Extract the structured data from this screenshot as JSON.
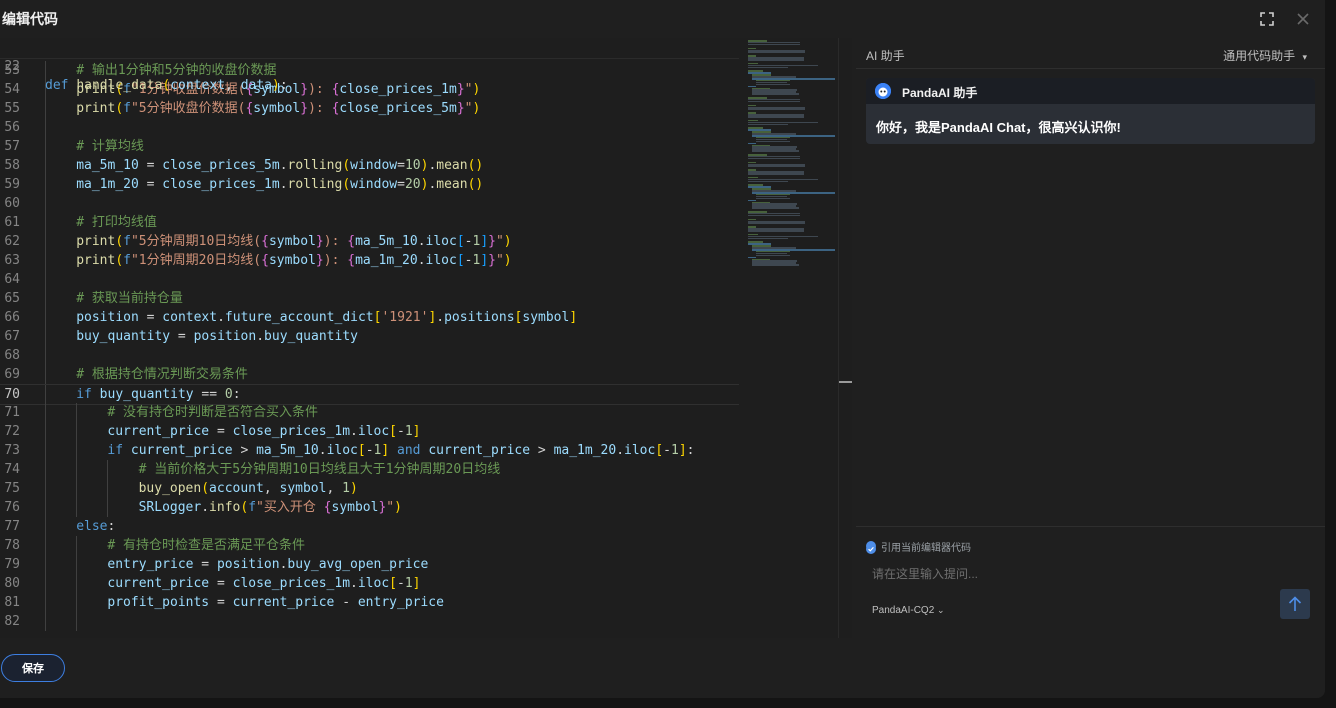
{
  "dialog": {
    "title": "编辑代码",
    "save_label": "保存"
  },
  "editor": {
    "sticky": {
      "ln": "22",
      "html": "<span class=\"tok-kw\">def</span> <span class=\"tok-fn\">handle_data</span><span class=\"tok-p1\">(</span><span class=\"tok-var\">context</span>, <span class=\"tok-var\">data</span><span class=\"tok-p1\">)</span>:"
    },
    "current_line": "70",
    "lines": [
      {
        "ln": "53",
        "indent": 1,
        "html": "<span class=\"tok-cm\"># 输出1分钟和5分钟的收盘价数据</span>"
      },
      {
        "ln": "54",
        "indent": 1,
        "html": "<span class=\"tok-fn\">print</span><span class=\"tok-p1\">(</span><span class=\"tok-kw\">f</span><span class=\"tok-str\">\"1分钟收盘价数据(</span><span class=\"tok-p2\">{</span><span class=\"tok-var\">symbol</span><span class=\"tok-p2\">}</span><span class=\"tok-str\">): </span><span class=\"tok-p2\">{</span><span class=\"tok-var\">close_prices_1m</span><span class=\"tok-p2\">}</span><span class=\"tok-str\">\"</span><span class=\"tok-p1\">)</span>"
      },
      {
        "ln": "55",
        "indent": 1,
        "html": "<span class=\"tok-fn\">print</span><span class=\"tok-p1\">(</span><span class=\"tok-kw\">f</span><span class=\"tok-str\">\"5分钟收盘价数据(</span><span class=\"tok-p2\">{</span><span class=\"tok-var\">symbol</span><span class=\"tok-p2\">}</span><span class=\"tok-str\">): </span><span class=\"tok-p2\">{</span><span class=\"tok-var\">close_prices_5m</span><span class=\"tok-p2\">}</span><span class=\"tok-str\">\"</span><span class=\"tok-p1\">)</span>"
      },
      {
        "ln": "56",
        "indent": 1,
        "html": ""
      },
      {
        "ln": "57",
        "indent": 1,
        "html": "<span class=\"tok-cm\"># 计算均线</span>"
      },
      {
        "ln": "58",
        "indent": 1,
        "html": "<span class=\"tok-var\">ma_5m_10</span> = <span class=\"tok-var\">close_prices_5m</span>.<span class=\"tok-fn\">rolling</span><span class=\"tok-p1\">(</span><span class=\"tok-var\">window</span>=<span class=\"tok-num\">10</span><span class=\"tok-p1\">)</span>.<span class=\"tok-fn\">mean</span><span class=\"tok-p1\">()</span>"
      },
      {
        "ln": "59",
        "indent": 1,
        "html": "<span class=\"tok-var\">ma_1m_20</span> = <span class=\"tok-var\">close_prices_1m</span>.<span class=\"tok-fn\">rolling</span><span class=\"tok-p1\">(</span><span class=\"tok-var\">window</span>=<span class=\"tok-num\">20</span><span class=\"tok-p1\">)</span>.<span class=\"tok-fn\">mean</span><span class=\"tok-p1\">()</span>"
      },
      {
        "ln": "60",
        "indent": 1,
        "html": ""
      },
      {
        "ln": "61",
        "indent": 1,
        "html": "<span class=\"tok-cm\"># 打印均线值</span>"
      },
      {
        "ln": "62",
        "indent": 1,
        "html": "<span class=\"tok-fn\">print</span><span class=\"tok-p1\">(</span><span class=\"tok-kw\">f</span><span class=\"tok-str\">\"5分钟周期10日均线(</span><span class=\"tok-p2\">{</span><span class=\"tok-var\">symbol</span><span class=\"tok-p2\">}</span><span class=\"tok-str\">): </span><span class=\"tok-p2\">{</span><span class=\"tok-var\">ma_5m_10</span>.<span class=\"tok-var\">iloc</span><span class=\"tok-p3\">[</span>-<span class=\"tok-num\">1</span><span class=\"tok-p3\">]</span><span class=\"tok-p2\">}</span><span class=\"tok-str\">\"</span><span class=\"tok-p1\">)</span>"
      },
      {
        "ln": "63",
        "indent": 1,
        "html": "<span class=\"tok-fn\">print</span><span class=\"tok-p1\">(</span><span class=\"tok-kw\">f</span><span class=\"tok-str\">\"1分钟周期20日均线(</span><span class=\"tok-p2\">{</span><span class=\"tok-var\">symbol</span><span class=\"tok-p2\">}</span><span class=\"tok-str\">): </span><span class=\"tok-p2\">{</span><span class=\"tok-var\">ma_1m_20</span>.<span class=\"tok-var\">iloc</span><span class=\"tok-p3\">[</span>-<span class=\"tok-num\">1</span><span class=\"tok-p3\">]</span><span class=\"tok-p2\">}</span><span class=\"tok-str\">\"</span><span class=\"tok-p1\">)</span>"
      },
      {
        "ln": "64",
        "indent": 1,
        "html": ""
      },
      {
        "ln": "65",
        "indent": 1,
        "html": "<span class=\"tok-cm\"># 获取当前持仓量</span>"
      },
      {
        "ln": "66",
        "indent": 1,
        "html": "<span class=\"tok-var\">position</span> = <span class=\"tok-var\">context</span>.<span class=\"tok-var\">future_account_dict</span><span class=\"tok-p1\">[</span><span class=\"tok-str\">'1921'</span><span class=\"tok-p1\">]</span>.<span class=\"tok-var\">positions</span><span class=\"tok-p1\">[</span><span class=\"tok-var\">symbol</span><span class=\"tok-p1\">]</span>"
      },
      {
        "ln": "67",
        "indent": 1,
        "html": "<span class=\"tok-var\">buy_quantity</span> = <span class=\"tok-var\">position</span>.<span class=\"tok-var\">buy_quantity</span>"
      },
      {
        "ln": "68",
        "indent": 1,
        "html": ""
      },
      {
        "ln": "69",
        "indent": 1,
        "html": "<span class=\"tok-cm\"># 根据持仓情况判断交易条件</span>"
      },
      {
        "ln": "70",
        "indent": 1,
        "html": "<span class=\"tok-kw\">if</span> <span class=\"tok-var\">buy_quantity</span> == <span class=\"tok-num\">0</span>:"
      },
      {
        "ln": "71",
        "indent": 2,
        "html": "<span class=\"tok-cm\"># 没有持仓时判断是否符合买入条件</span>"
      },
      {
        "ln": "72",
        "indent": 2,
        "html": "<span class=\"tok-var\">current_price</span> = <span class=\"tok-var\">close_prices_1m</span>.<span class=\"tok-var\">iloc</span><span class=\"tok-p1\">[</span>-<span class=\"tok-num\">1</span><span class=\"tok-p1\">]</span>"
      },
      {
        "ln": "73",
        "indent": 2,
        "html": "<span class=\"tok-kw\">if</span> <span class=\"tok-var\">current_price</span> &gt; <span class=\"tok-var\">ma_5m_10</span>.<span class=\"tok-var\">iloc</span><span class=\"tok-p1\">[</span>-<span class=\"tok-num\">1</span><span class=\"tok-p1\">]</span> <span class=\"tok-kw\">and</span> <span class=\"tok-var\">current_price</span> &gt; <span class=\"tok-var\">ma_1m_20</span>.<span class=\"tok-var\">iloc</span><span class=\"tok-p1\">[</span>-<span class=\"tok-num\">1</span><span class=\"tok-p1\">]</span>:"
      },
      {
        "ln": "74",
        "indent": 3,
        "html": "<span class=\"tok-cm\"># 当前价格大于5分钟周期10日均线且大于1分钟周期20日均线</span>"
      },
      {
        "ln": "75",
        "indent": 3,
        "html": "<span class=\"tok-fn\">buy_open</span><span class=\"tok-p1\">(</span><span class=\"tok-var\">account</span>, <span class=\"tok-var\">symbol</span>, <span class=\"tok-num\">1</span><span class=\"tok-p1\">)</span>"
      },
      {
        "ln": "76",
        "indent": 3,
        "html": "<span class=\"tok-var\">SRLogger</span>.<span class=\"tok-fn\">info</span><span class=\"tok-p1\">(</span><span class=\"tok-kw\">f</span><span class=\"tok-str\">\"买入开仓 </span><span class=\"tok-p2\">{</span><span class=\"tok-var\">symbol</span><span class=\"tok-p2\">}</span><span class=\"tok-str\">\"</span><span class=\"tok-p1\">)</span>"
      },
      {
        "ln": "77",
        "indent": 1,
        "html": "<span class=\"tok-kw\">else</span>:"
      },
      {
        "ln": "78",
        "indent": 2,
        "html": "<span class=\"tok-cm\"># 有持仓时检查是否满足平仓条件</span>"
      },
      {
        "ln": "79",
        "indent": 2,
        "html": "<span class=\"tok-var\">entry_price</span> = <span class=\"tok-var\">position</span>.<span class=\"tok-var\">buy_avg_open_price</span>"
      },
      {
        "ln": "80",
        "indent": 2,
        "html": "<span class=\"tok-var\">current_price</span> = <span class=\"tok-var\">close_prices_1m</span>.<span class=\"tok-var\">iloc</span><span class=\"tok-p1\">[</span>-<span class=\"tok-num\">1</span><span class=\"tok-p1\">]</span>"
      },
      {
        "ln": "81",
        "indent": 2,
        "html": "<span class=\"tok-var\">profit_points</span> = <span class=\"tok-var\">current_price</span> - <span class=\"tok-var\">entry_price</span>"
      },
      {
        "ln": "82",
        "indent": 2,
        "html": ""
      }
    ]
  },
  "ai": {
    "title": "AI 助手",
    "mode_label": "通用代码助手",
    "message": {
      "sender": "PandaAI 助手",
      "text": "你好，我是PandaAI Chat，很高兴认识你!"
    },
    "reference_label": "引用当前编辑器代码",
    "input_placeholder": "请在这里输入提问...",
    "model_label": "PandaAI-CQ2"
  },
  "colors": {
    "accent": "#3d7ee0",
    "background": "#1f1f1f",
    "editor_bg": "#1e1e1e"
  }
}
